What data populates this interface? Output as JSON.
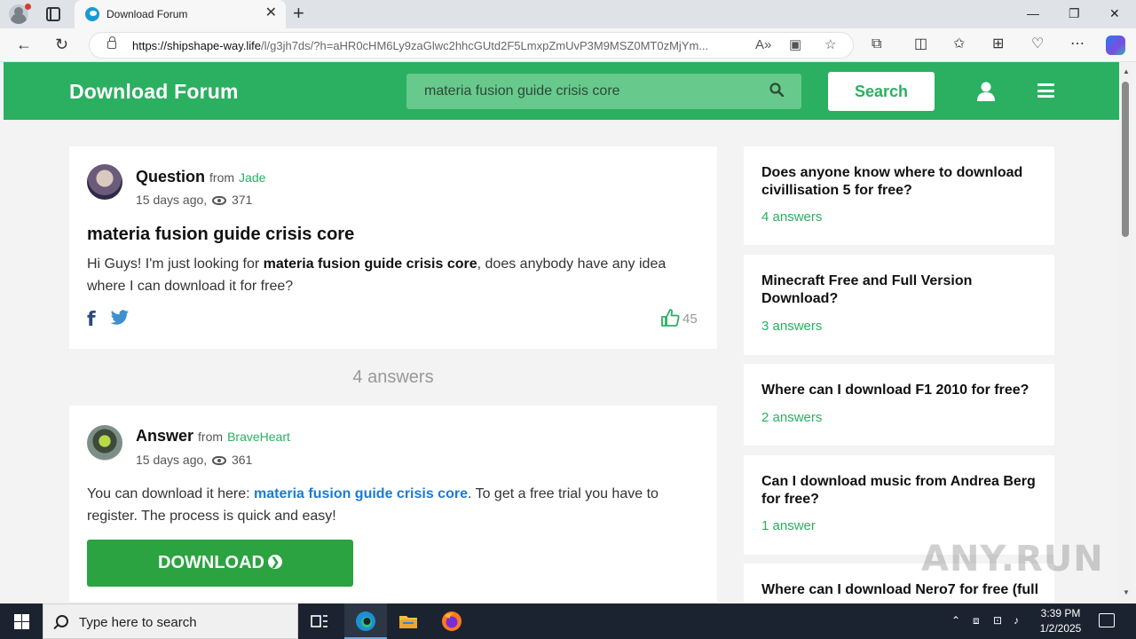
{
  "browser": {
    "tab_title": "Download Forum",
    "url_host": "https://shipshape-way.life",
    "url_rest": "/l/g3jh7ds/?h=aHR0cHM6Ly9zaGlwc2hhcGUtd2F5LmxpZmUvP3M9MSZ0MT0zMjYm..."
  },
  "site": {
    "brand": "Download Forum",
    "search_value": "materia fusion guide crisis core",
    "search_button": "Search"
  },
  "question": {
    "heading": "Question",
    "from_label": "from",
    "author": "Jade",
    "age": "15 days ago,",
    "views": "371",
    "title": "materia fusion guide crisis core",
    "body_pre": "Hi Guys! I'm just looking for ",
    "body_bold": "materia fusion guide crisis core",
    "body_post": ", does anybody have any idea where I can download it for free?",
    "likes": "45"
  },
  "answers_count": "4 answers",
  "answer": {
    "heading": "Answer",
    "from_label": "from",
    "author": "BraveHeart",
    "age": "15 days ago,",
    "views": "361",
    "body_pre": "You can download it here: ",
    "link_text": "materia fusion guide crisis core",
    "body_post": ". To get a free trial you have to register. The process is quick and easy!",
    "download_label": "DOWNLOAD"
  },
  "sidebar": [
    {
      "title": "Does anyone know where to download civillisation 5 for free?",
      "answers": "4 answers"
    },
    {
      "title": "Minecraft Free and Full Version Download?",
      "answers": "3 answers"
    },
    {
      "title": "Where can I download F1 2010 for free?",
      "answers": "2 answers"
    },
    {
      "title": "Can I download music from Andrea Berg for free?",
      "answers": "1 answer"
    },
    {
      "title": "Where can I download Nero7 for free (full"
    }
  ],
  "watermark": "ANY.RUN",
  "taskbar": {
    "search_placeholder": "Type here to search",
    "time": "3:39 PM",
    "date": "1/2/2025"
  }
}
